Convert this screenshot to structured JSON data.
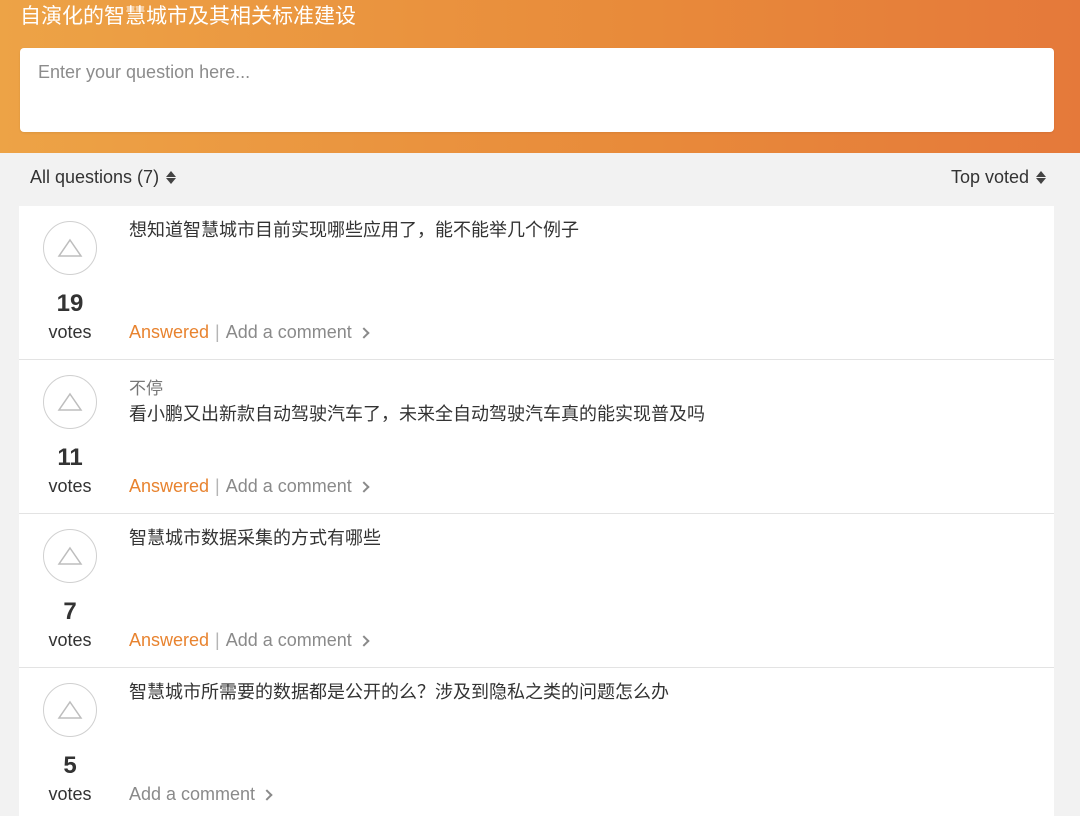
{
  "header": {
    "title": "自演化的智慧城市及其相关标准建设",
    "input_placeholder": "Enter your question here..."
  },
  "toolbar": {
    "filter_label": "All questions (7)",
    "sort_label": "Top voted"
  },
  "questions": [
    {
      "votes": "19",
      "votes_label": "votes",
      "author": "",
      "text": "想知道智慧城市目前实现哪些应用了，能不能举几个例子",
      "status": "Answered",
      "separator": "|",
      "comment_label": "Add a comment"
    },
    {
      "votes": "11",
      "votes_label": "votes",
      "author": "不停",
      "text": "看小鹏又出新款自动驾驶汽车了，未来全自动驾驶汽车真的能实现普及吗",
      "status": "Answered",
      "separator": "|",
      "comment_label": "Add a comment"
    },
    {
      "votes": "7",
      "votes_label": "votes",
      "author": "",
      "text": "智慧城市数据采集的方式有哪些",
      "status": "Answered",
      "separator": "|",
      "comment_label": "Add a comment"
    },
    {
      "votes": "5",
      "votes_label": "votes",
      "author": "",
      "text": "智慧城市所需要的数据都是公开的么？涉及到隐私之类的问题怎么办",
      "status": "",
      "separator": "",
      "comment_label": "Add a comment"
    }
  ],
  "colors": {
    "header_start": "#eda346",
    "header_end": "#e5793a",
    "answered": "#e8832f"
  },
  "icons": {
    "vote": "upvote-triangle-icon",
    "sort": "sort-updown-icon",
    "comment": "chevron-right-icon"
  }
}
